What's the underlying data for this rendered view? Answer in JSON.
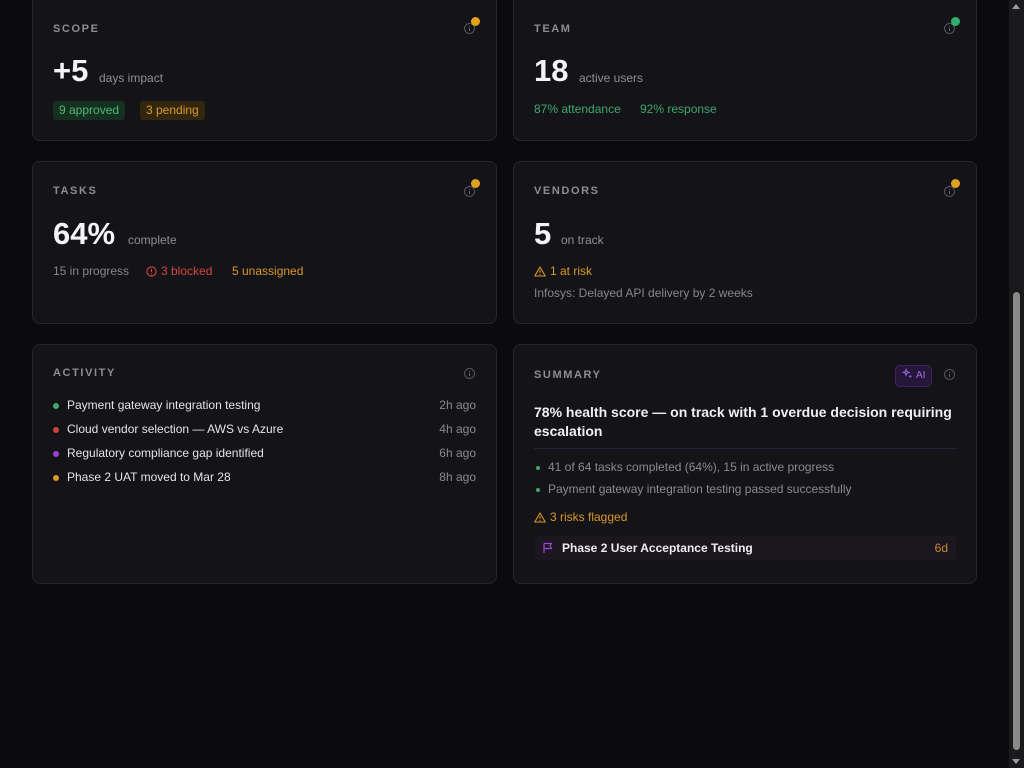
{
  "colors": {
    "background": "#0b0b0d",
    "card": "#141418",
    "green": "#3ea96b",
    "amber": "#d9982a",
    "red": "#d6463e",
    "purple": "#a46be0"
  },
  "scope": {
    "label": "SCOPE",
    "value": "+5",
    "unit": "days impact",
    "status_color": "#e0a020",
    "approved": "9 approved",
    "pending": "3 pending",
    "info_icon": "info-icon"
  },
  "team": {
    "label": "TEAM",
    "value": "18",
    "unit": "active users",
    "status_color": "#2fb06a",
    "attendance": "87% attendance",
    "response": "92% response",
    "info_icon": "info-icon"
  },
  "tasks": {
    "label": "TASKS",
    "value": "64%",
    "unit": "complete",
    "status_color": "#e0a020",
    "in_progress": "15 in progress",
    "blocked": "3 blocked",
    "unassigned": "5 unassigned",
    "info_icon": "info-icon"
  },
  "vendors": {
    "label": "VENDORS",
    "value": "5",
    "unit": "on track",
    "status_color": "#e0a020",
    "at_risk": "1 at risk",
    "note": "Infosys: Delayed API delivery by 2 weeks",
    "info_icon": "info-icon"
  },
  "activity": {
    "label": "ACTIVITY",
    "items": [
      {
        "text": "Payment gateway integration testing",
        "time": "2h ago",
        "color": "#3ea96b"
      },
      {
        "text": "Cloud vendor selection — AWS vs Azure",
        "time": "4h ago",
        "color": "#c8403a"
      },
      {
        "text": "Regulatory compliance gap identified",
        "time": "6h ago",
        "color": "#9b3fd6"
      },
      {
        "text": "Phase 2 UAT moved to Mar 28",
        "time": "8h ago",
        "color": "#d9982a"
      }
    ]
  },
  "summary": {
    "label": "SUMMARY",
    "ai_badge": "AI",
    "headline": "78% health score — on track with 1 overdue decision requiring escalation",
    "bullets": [
      "41 of 64 tasks completed (64%), 15 in active progress",
      "Payment gateway integration testing passed successfully"
    ],
    "risks": "3 risks flagged",
    "milestone": {
      "text": "Phase 2 User Acceptance Testing",
      "days": "6d"
    }
  }
}
